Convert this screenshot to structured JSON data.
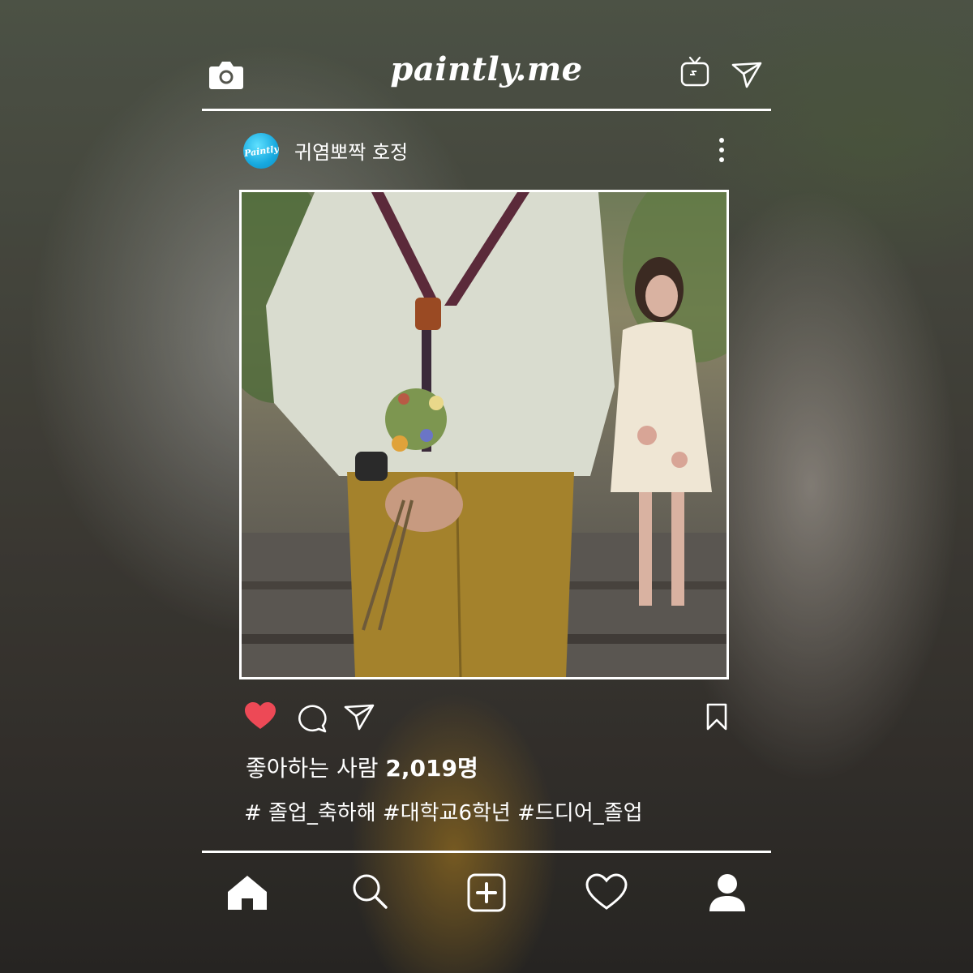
{
  "header": {
    "brand": "paintly.me",
    "icons": [
      "camera-icon",
      "tv-icon",
      "send-icon"
    ]
  },
  "post": {
    "username": "귀염뽀짝 호정",
    "avatar_text": "Paintly",
    "likes_prefix": "좋아하는 사람",
    "likes_count": "2,019명",
    "hashtags": "# 졸업_축하해 #대학교6학년 #드디어_졸업",
    "liked": true,
    "like_color": "#ed4956"
  },
  "actions": [
    "heart-icon",
    "comment-icon",
    "share-icon",
    "bookmark-icon"
  ],
  "bottom_nav": [
    "home-icon",
    "search-icon",
    "add-post-icon",
    "activity-heart-icon",
    "profile-icon"
  ]
}
